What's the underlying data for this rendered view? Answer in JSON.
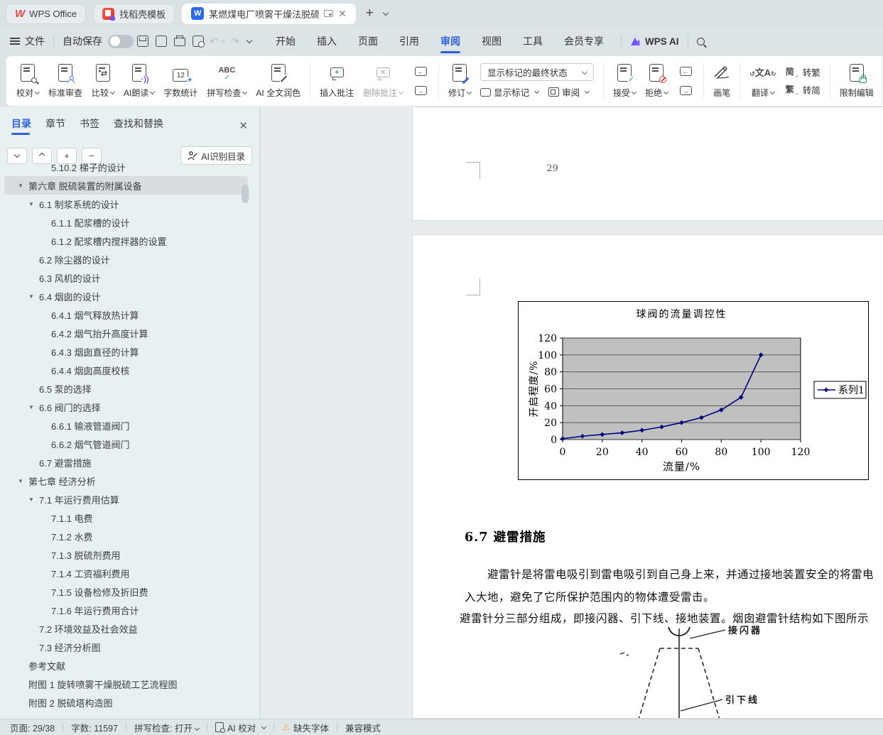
{
  "window": {
    "tabs": [
      {
        "label": "WPS Office"
      },
      {
        "label": "找稻壳模板"
      },
      {
        "label": "某燃煤电厂喷雾干燥法脱硫系",
        "active": true
      }
    ]
  },
  "menu": {
    "file_label": "文件",
    "autosave_label": "自动保存",
    "tabs": [
      "开始",
      "插入",
      "页面",
      "引用",
      "审阅",
      "视图",
      "工具",
      "会员专享"
    ],
    "active_tab": "审阅",
    "wps_ai_label": "WPS AI"
  },
  "ribbon": {
    "proof": "校对",
    "standard_review": "标准审查",
    "compare": "比较",
    "ai_read": "AI朗读",
    "word_count": "字数统计",
    "word_count_icon_text": "12",
    "spell_check": "拼写检查",
    "spell_icon_text": "ABC",
    "ai_polish": "AI 全文润色",
    "insert_comment": "插入批注",
    "delete_comment": "删除批注",
    "track_changes": "修订",
    "markup_state": "显示标记的最终状态",
    "show_markup": "显示标记",
    "review_pane": "审阅",
    "accept": "接受",
    "reject": "拒绝",
    "pen": "画笔",
    "translate": "翻译",
    "translate_icon_text": "文A",
    "to_trad_icon": "简",
    "to_trad": "转繁",
    "to_simp_icon": "繁",
    "to_simp": "转简",
    "restrict_edit": "限制编辑",
    "clipped_item": "文"
  },
  "sidebar": {
    "tabs": [
      "目录",
      "章节",
      "书签",
      "查找和替换"
    ],
    "active_tab": "目录",
    "ai_toc_button": "AI识别目录",
    "toc": [
      {
        "level": 3,
        "label": "5.10.2 梯子的设计"
      },
      {
        "level": 0,
        "label": "第六章 脱硫装置的附属设备",
        "arrow": true,
        "selected": true
      },
      {
        "level": 1,
        "label": "6.1 制浆系统的设计",
        "arrow": true
      },
      {
        "level": 2,
        "label": "6.1.1 配浆槽的设计"
      },
      {
        "level": 2,
        "label": "6.1.2 配浆槽内搅拌器的设置"
      },
      {
        "level": 1,
        "label": "6.2 除尘器的设计"
      },
      {
        "level": 1,
        "label": "6.3 风机的设计"
      },
      {
        "level": 1,
        "label": "6.4 烟囱的设计",
        "arrow": true
      },
      {
        "level": 2,
        "label": "6.4.1 烟气释放热计算"
      },
      {
        "level": 2,
        "label": "6.4.2 烟气抬升高度计算"
      },
      {
        "level": 2,
        "label": "6.4.3 烟囱直径的计算"
      },
      {
        "level": 2,
        "label": "6.4.4 烟囱高度校核"
      },
      {
        "level": 1,
        "label": "6.5 泵的选择"
      },
      {
        "level": 1,
        "label": "6.6 阀门的选择",
        "arrow": true
      },
      {
        "level": 2,
        "label": "6.6.1 输液管道阀门"
      },
      {
        "level": 2,
        "label": "6.6.2 烟气管道阀门"
      },
      {
        "level": 1,
        "label": "6.7 避雷措施"
      },
      {
        "level": 0,
        "label": "第七章 经济分析",
        "arrow": true
      },
      {
        "level": 1,
        "label": "7.1 年运行费用估算",
        "arrow": true
      },
      {
        "level": 2,
        "label": "7.1.1 电费"
      },
      {
        "level": 2,
        "label": "7.1.2 水费"
      },
      {
        "level": 2,
        "label": "7.1.3 脱硫剂费用"
      },
      {
        "level": 2,
        "label": "7.1.4 工资福利费用"
      },
      {
        "level": 2,
        "label": "7.1.5 设备检修及折旧费"
      },
      {
        "level": 2,
        "label": "7.1.6 年运行费用合计"
      },
      {
        "level": 1,
        "label": "7.2 环境效益及社会效益"
      },
      {
        "level": 1,
        "label": "7.3 经济分析图"
      },
      {
        "level": 0,
        "label": "参考文献"
      },
      {
        "level": 0,
        "label": "附图 1 旋转喷雾干燥脱硫工艺流程图"
      },
      {
        "level": 0,
        "label": "附图 2 脱硫塔构造图"
      }
    ]
  },
  "document": {
    "page_footer_number": "29",
    "heading": "6.7  避雷措施",
    "para_line1": "避雷针是将雷电吸引到雷电吸引到自己身上来，并通过接地装置安全的将雷电",
    "para_line2": "入大地，避免了它所保护范围内的物体遭受雷击。",
    "para_line3": "避雷针分三部分组成，即接闪器、引下线、接地装置。烟囱避雷针结构如下图所示",
    "figure_label_top": "接闪器",
    "figure_label_bottom": "引下线"
  },
  "chart_data": {
    "type": "line",
    "title": "球阀的流量调控性",
    "xlabel": "流量/%",
    "ylabel": "开启程度/%",
    "x": [
      0,
      10,
      20,
      30,
      40,
      50,
      60,
      70,
      80,
      90,
      100
    ],
    "series": [
      {
        "name": "系列1",
        "values": [
          1,
          4,
          6,
          8,
          11,
          15,
          20,
          26,
          35,
          50,
          100
        ]
      }
    ],
    "xlim": [
      0,
      120
    ],
    "ylim": [
      0,
      120
    ],
    "xticks": [
      0,
      20,
      40,
      60,
      80,
      100,
      120
    ],
    "yticks": [
      0,
      20,
      40,
      60,
      80,
      100,
      120
    ],
    "grid": true,
    "legend_position": "right",
    "colors": {
      "series": "#000080",
      "plot_bg": "#c0c0c0"
    }
  },
  "statusbar": {
    "page": "页面: 29/38",
    "words": "字数: 11597",
    "spell": "拼写检查: 打开",
    "ai_proof": "AI 校对",
    "missing_font": "缺失字体",
    "compat_mode": "兼容模式"
  }
}
